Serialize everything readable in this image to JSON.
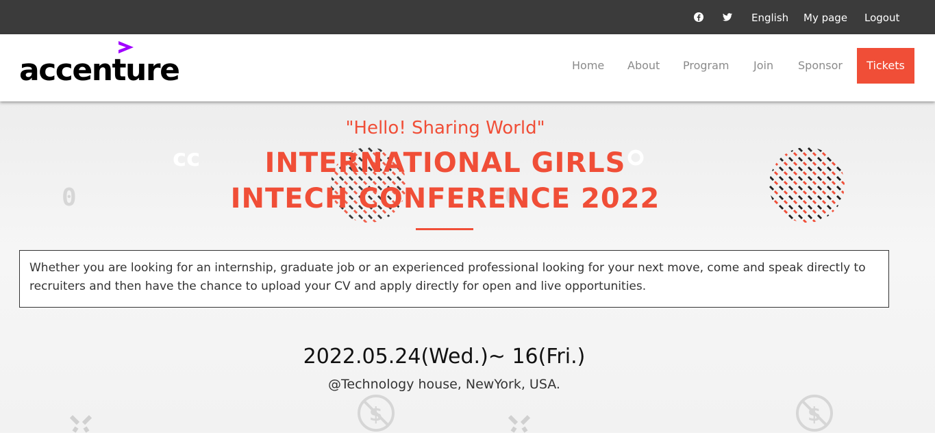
{
  "topbar": {
    "facebook_icon": "facebook-icon",
    "twitter_icon": "twitter-icon",
    "language": "English",
    "my_page": "My page",
    "logout": "Logout"
  },
  "brand": {
    "logo_text": "accenture",
    "logo_mark_color": "#a100ff"
  },
  "nav": {
    "home": "Home",
    "about": "About",
    "program": "Program",
    "join": "Join",
    "sponsor": "Sponsor",
    "tickets": "Tickets"
  },
  "hero": {
    "tagline": "\"Hello! Sharing World\"",
    "title_line1": "INTERNATIONAL GIRLS",
    "title_line2": "INTECH CONFERENCE 2022",
    "description": "Whether you are looking for an internship, graduate job or an experienced professional looking for your next move, come and speak directly to recruiters and then have the chance to upload your CV and apply directly for open and live opportunities.",
    "date": "2022.05.24(Wed.)~ 16(Fri.)",
    "venue": "@Technology house, NewYork, USA."
  },
  "colors": {
    "accent": "#f04e37",
    "topbar_bg": "#3b3b3b",
    "logo_mark": "#a100ff"
  }
}
